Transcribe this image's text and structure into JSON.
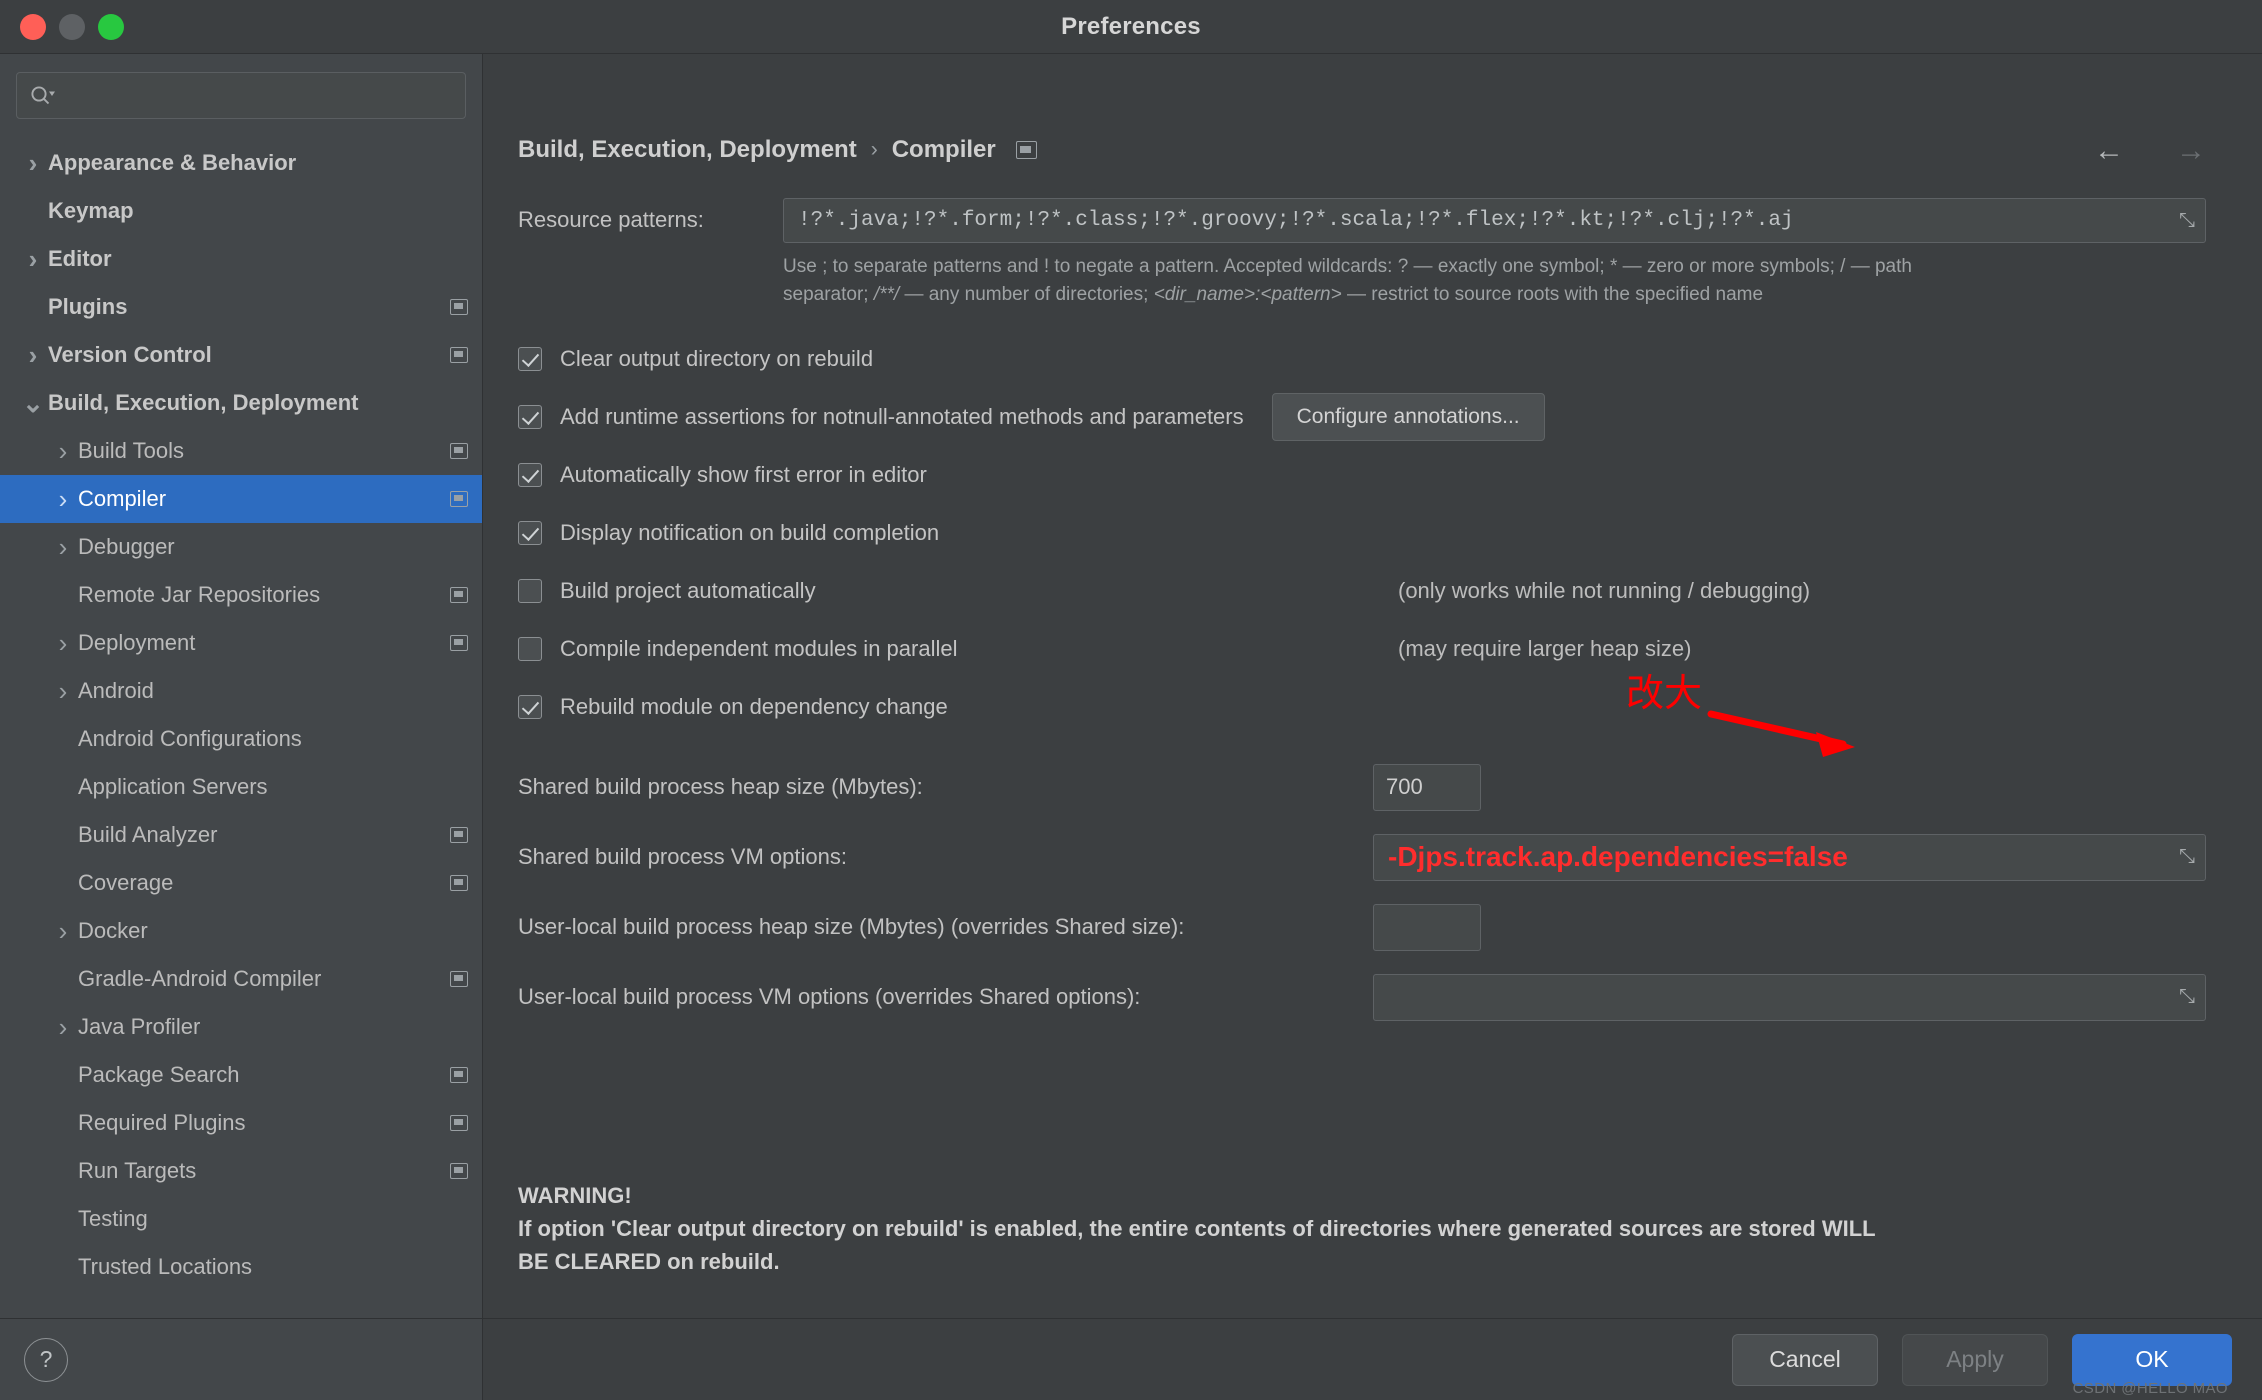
{
  "window": {
    "title": "Preferences",
    "traffic_lights": [
      "close",
      "minimize",
      "zoom"
    ]
  },
  "sidebar": {
    "search": {
      "value": "",
      "placeholder": ""
    },
    "items": [
      {
        "label": "Appearance & Behavior",
        "indent": 0,
        "chevron": "right",
        "bold": true,
        "badge": false,
        "selected": false
      },
      {
        "label": "Keymap",
        "indent": 0,
        "chevron": "none",
        "bold": true,
        "badge": false,
        "selected": false
      },
      {
        "label": "Editor",
        "indent": 0,
        "chevron": "right",
        "bold": true,
        "badge": false,
        "selected": false
      },
      {
        "label": "Plugins",
        "indent": 0,
        "chevron": "none",
        "bold": true,
        "badge": true,
        "selected": false
      },
      {
        "label": "Version Control",
        "indent": 0,
        "chevron": "right",
        "bold": true,
        "badge": true,
        "selected": false
      },
      {
        "label": "Build, Execution, Deployment",
        "indent": 0,
        "chevron": "down",
        "bold": true,
        "badge": false,
        "selected": false
      },
      {
        "label": "Build Tools",
        "indent": 1,
        "chevron": "right",
        "bold": false,
        "badge": true,
        "selected": false
      },
      {
        "label": "Compiler",
        "indent": 1,
        "chevron": "right",
        "bold": false,
        "badge": true,
        "selected": true
      },
      {
        "label": "Debugger",
        "indent": 1,
        "chevron": "right",
        "bold": false,
        "badge": false,
        "selected": false
      },
      {
        "label": "Remote Jar Repositories",
        "indent": 1,
        "chevron": "none",
        "bold": false,
        "badge": true,
        "selected": false
      },
      {
        "label": "Deployment",
        "indent": 1,
        "chevron": "right",
        "bold": false,
        "badge": true,
        "selected": false
      },
      {
        "label": "Android",
        "indent": 1,
        "chevron": "right",
        "bold": false,
        "badge": false,
        "selected": false
      },
      {
        "label": "Android Configurations",
        "indent": 1,
        "chevron": "none",
        "bold": false,
        "badge": false,
        "selected": false
      },
      {
        "label": "Application Servers",
        "indent": 1,
        "chevron": "none",
        "bold": false,
        "badge": false,
        "selected": false
      },
      {
        "label": "Build Analyzer",
        "indent": 1,
        "chevron": "none",
        "bold": false,
        "badge": true,
        "selected": false
      },
      {
        "label": "Coverage",
        "indent": 1,
        "chevron": "none",
        "bold": false,
        "badge": true,
        "selected": false
      },
      {
        "label": "Docker",
        "indent": 1,
        "chevron": "right",
        "bold": false,
        "badge": false,
        "selected": false
      },
      {
        "label": "Gradle-Android Compiler",
        "indent": 1,
        "chevron": "none",
        "bold": false,
        "badge": true,
        "selected": false
      },
      {
        "label": "Java Profiler",
        "indent": 1,
        "chevron": "right",
        "bold": false,
        "badge": false,
        "selected": false
      },
      {
        "label": "Package Search",
        "indent": 1,
        "chevron": "none",
        "bold": false,
        "badge": true,
        "selected": false
      },
      {
        "label": "Required Plugins",
        "indent": 1,
        "chevron": "none",
        "bold": false,
        "badge": true,
        "selected": false
      },
      {
        "label": "Run Targets",
        "indent": 1,
        "chevron": "none",
        "bold": false,
        "badge": true,
        "selected": false
      },
      {
        "label": "Testing",
        "indent": 1,
        "chevron": "none",
        "bold": false,
        "badge": false,
        "selected": false
      },
      {
        "label": "Trusted Locations",
        "indent": 1,
        "chevron": "none",
        "bold": false,
        "badge": false,
        "selected": false
      }
    ],
    "help_label": "?"
  },
  "breadcrumb": {
    "root": "Build, Execution, Deployment",
    "separator": "›",
    "current": "Compiler",
    "back_arrow": "←",
    "forward_arrow": "→"
  },
  "main": {
    "resource_patterns": {
      "label": "Resource patterns:",
      "value": "!?*.java;!?*.form;!?*.class;!?*.groovy;!?*.scala;!?*.flex;!?*.kt;!?*.clj;!?*.aj",
      "expand_icon": "⤡"
    },
    "hint_line1_a": "Use ; to separate patterns and ! to negate a pattern. Accepted wildcards: ? — exactly one symbol; * — zero or more symbols; / — path",
    "hint_line2_a": "separator; ",
    "hint_line2_b": "/**/",
    "hint_line2_c": " — any number of directories; ",
    "hint_line2_d": "<dir_name>:<pattern>",
    "hint_line2_e": " — restrict to source roots with the specified name",
    "checkboxes": [
      {
        "label": "Clear output directory on rebuild",
        "checked": true,
        "note": ""
      },
      {
        "label": "Add runtime assertions for notnull-annotated methods and parameters",
        "checked": true,
        "note": "",
        "button": "Configure annotations..."
      },
      {
        "label": "Automatically show first error in editor",
        "checked": true,
        "note": ""
      },
      {
        "label": "Display notification on build completion",
        "checked": true,
        "note": ""
      },
      {
        "label": "Build project automatically",
        "checked": false,
        "note": "(only works while not running / debugging)"
      },
      {
        "label": "Compile independent modules in parallel",
        "checked": false,
        "note": "(may require larger heap size)"
      },
      {
        "label": "Rebuild module on dependency change",
        "checked": true,
        "note": ""
      }
    ],
    "fields": [
      {
        "label": "Shared build process heap size (Mbytes):",
        "value": "700",
        "kind": "number",
        "red": false
      },
      {
        "label": "Shared build process VM options:",
        "value": "-Djps.track.ap.dependencies=false",
        "kind": "wide",
        "red": true,
        "expand_icon": "⤡"
      },
      {
        "label": "User-local build process heap size (Mbytes) (overrides Shared size):",
        "value": "",
        "kind": "number",
        "red": false
      },
      {
        "label": "User-local build process VM options (overrides Shared options):",
        "value": "",
        "kind": "wide",
        "red": false,
        "expand_icon": "⤡"
      }
    ],
    "warning_title": "WARNING!",
    "warning_line1": "If option 'Clear output directory on rebuild' is enabled, the entire contents of directories where generated sources are stored WILL",
    "warning_line2": "BE CLEARED on rebuild."
  },
  "annotations": {
    "label": "改大",
    "color": "#fe0000"
  },
  "footer": {
    "cancel": "Cancel",
    "apply": "Apply",
    "ok": "OK",
    "watermark": "CSDN @HELLO MAO"
  }
}
